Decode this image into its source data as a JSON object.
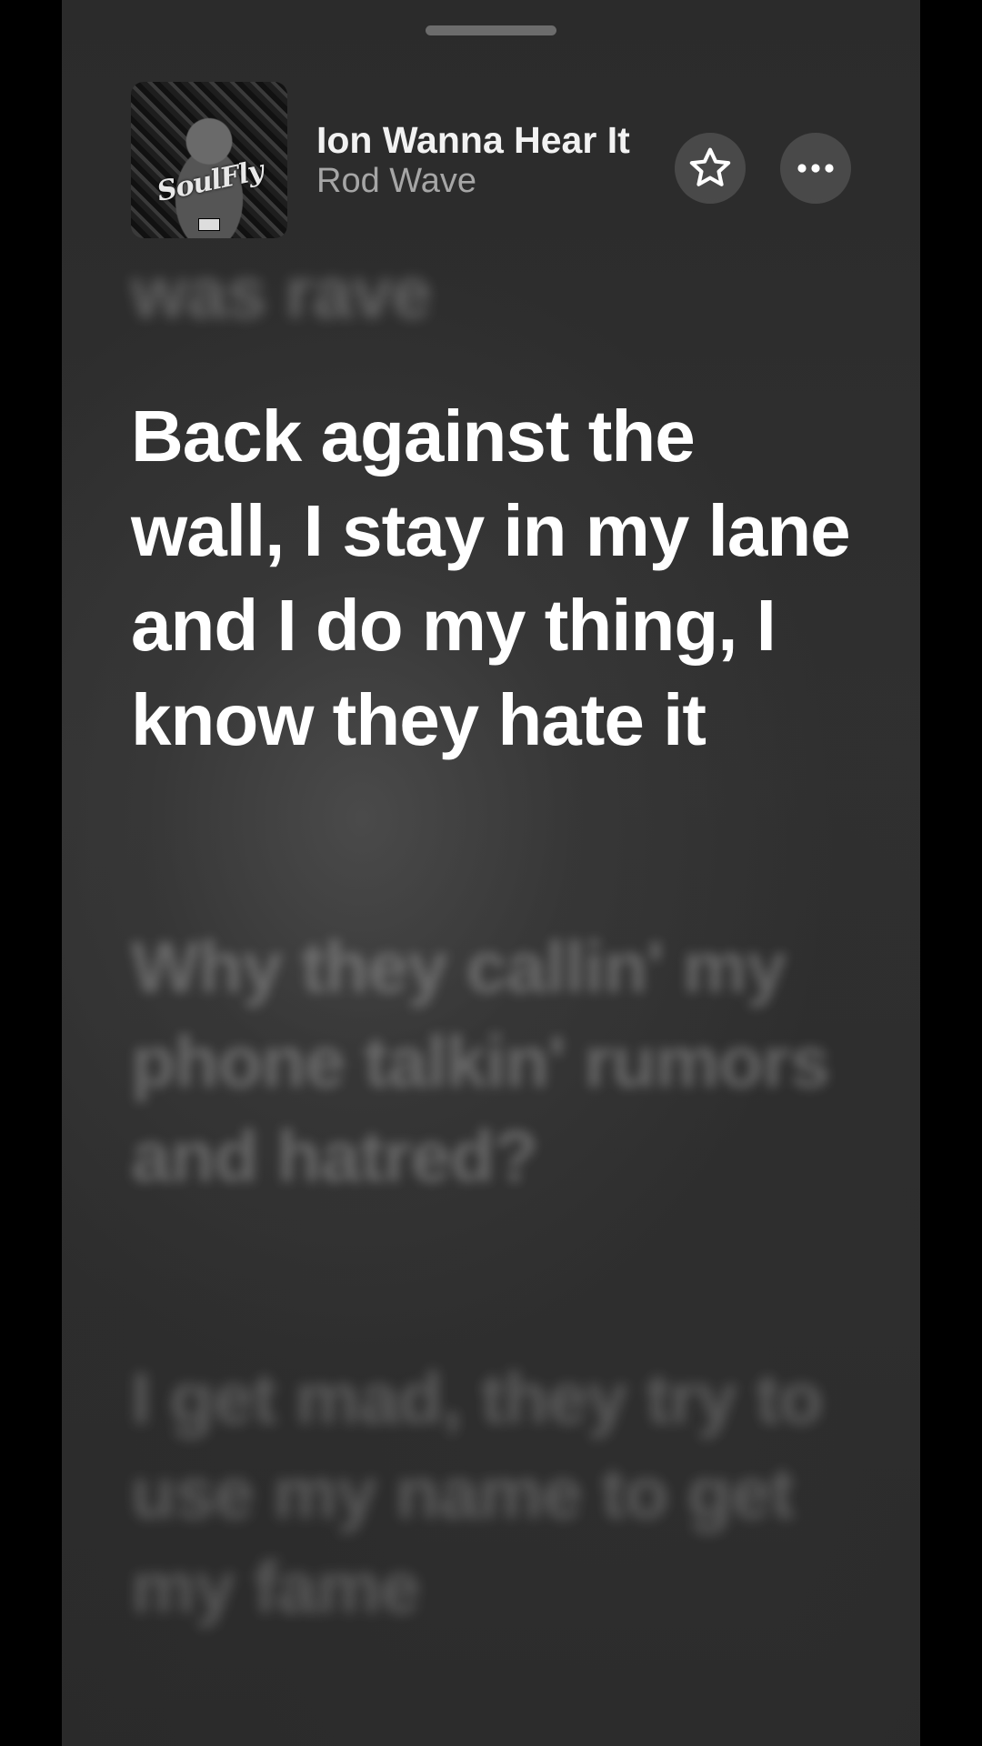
{
  "now_playing": {
    "title": "Ion Wanna Hear It",
    "artist": "Rod Wave",
    "artwork_text": "SoulFly",
    "artwork_icon": "album-artwork"
  },
  "controls": {
    "favorite_icon": "star-outline-icon",
    "more_icon": "ellipsis-icon"
  },
  "lyrics": {
    "previous_line": "was rave",
    "current_line": "Back against the wall, I stay in my lane and I do my thing, I know they hate it",
    "next_lines": [
      "Why they callin' my phone talkin' rumors and hatred?",
      "I get mad, they try to use my name to get my fame",
      ""
    ]
  },
  "colors": {
    "background": "#2c2c2c",
    "active_lyric": "#ffffff",
    "artist_text": "#a6a6a6",
    "button_bg": "rgba(255,255,255,0.14)"
  }
}
